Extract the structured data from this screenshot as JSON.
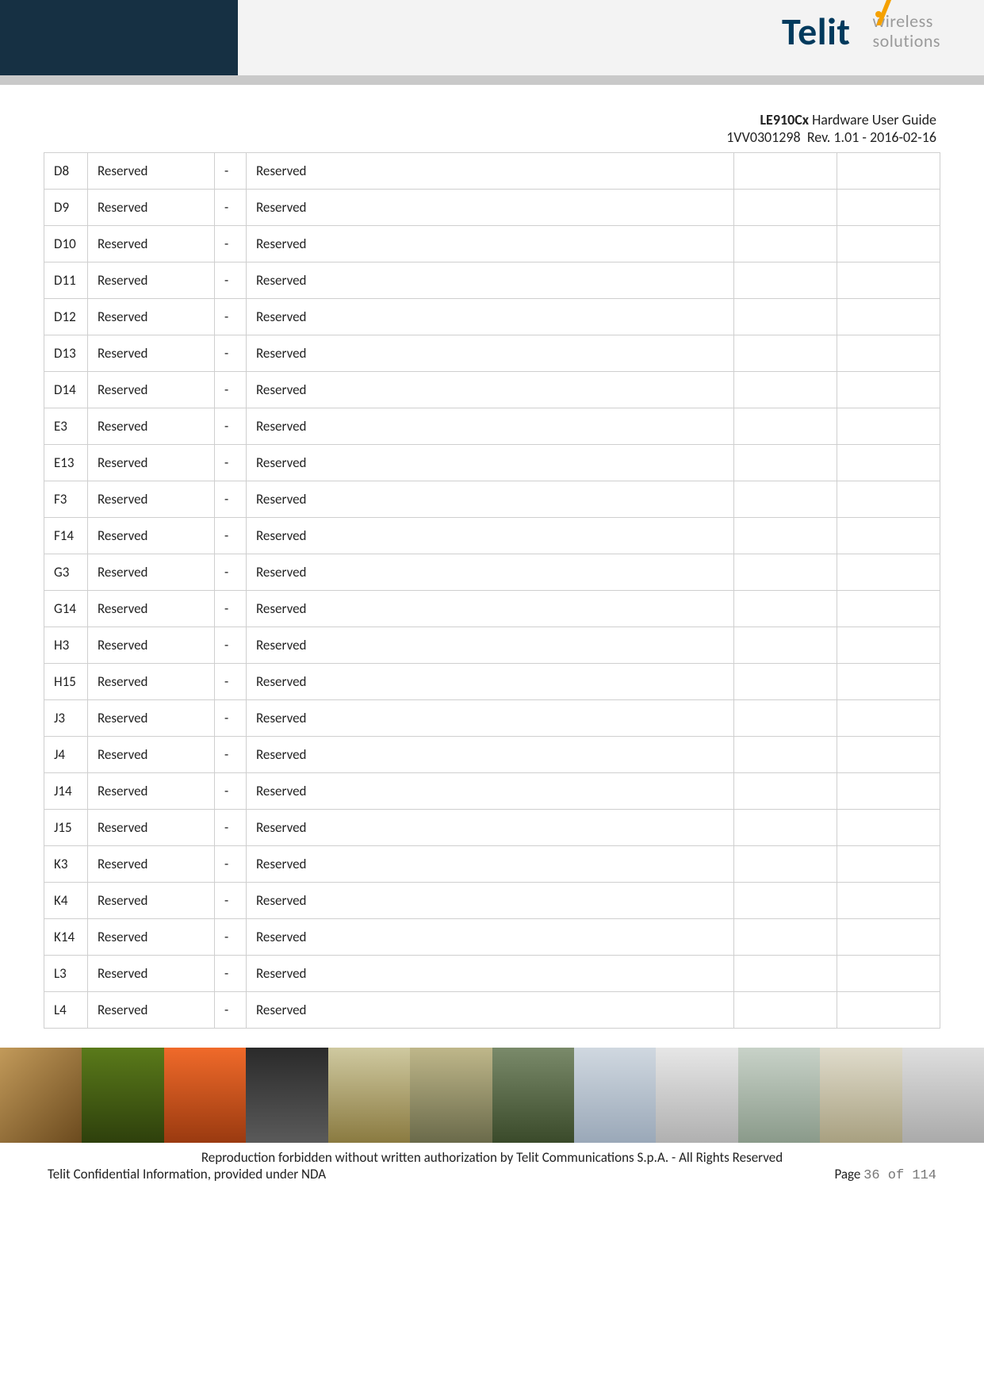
{
  "header": {
    "logo_text": "Telit",
    "tagline_l1": "wireless",
    "tagline_l2": "solutions"
  },
  "meta": {
    "title_bold": "LE910Cx",
    "title_rest": " Hardware User Guide",
    "docnum": "1VV0301298",
    "rev": "Rev. 1.01 - 2016-02-16"
  },
  "rows": [
    {
      "pin": "D8",
      "name": "Reserved",
      "io": "-",
      "func": "Reserved",
      "c5": "",
      "c6": ""
    },
    {
      "pin": "D9",
      "name": "Reserved",
      "io": "-",
      "func": "Reserved",
      "c5": "",
      "c6": ""
    },
    {
      "pin": "D10",
      "name": "Reserved",
      "io": "-",
      "func": "Reserved",
      "c5": "",
      "c6": ""
    },
    {
      "pin": "D11",
      "name": "Reserved",
      "io": "-",
      "func": "Reserved",
      "c5": "",
      "c6": ""
    },
    {
      "pin": "D12",
      "name": "Reserved",
      "io": "-",
      "func": "Reserved",
      "c5": "",
      "c6": ""
    },
    {
      "pin": "D13",
      "name": "Reserved",
      "io": "-",
      "func": "Reserved",
      "c5": "",
      "c6": ""
    },
    {
      "pin": "D14",
      "name": "Reserved",
      "io": "-",
      "func": "Reserved",
      "c5": "",
      "c6": ""
    },
    {
      "pin": "E3",
      "name": "Reserved",
      "io": "-",
      "func": "Reserved",
      "c5": "",
      "c6": ""
    },
    {
      "pin": "E13",
      "name": "Reserved",
      "io": "-",
      "func": "Reserved",
      "c5": "",
      "c6": ""
    },
    {
      "pin": "F3",
      "name": "Reserved",
      "io": "-",
      "func": "Reserved",
      "c5": "",
      "c6": ""
    },
    {
      "pin": "F14",
      "name": "Reserved",
      "io": "-",
      "func": "Reserved",
      "c5": "",
      "c6": ""
    },
    {
      "pin": "G3",
      "name": "Reserved",
      "io": "-",
      "func": "Reserved",
      "c5": "",
      "c6": ""
    },
    {
      "pin": "G14",
      "name": "Reserved",
      "io": "-",
      "func": "Reserved",
      "c5": "",
      "c6": ""
    },
    {
      "pin": "H3",
      "name": "Reserved",
      "io": "-",
      "func": "Reserved",
      "c5": "",
      "c6": ""
    },
    {
      "pin": "H15",
      "name": "Reserved",
      "io": "-",
      "func": "Reserved",
      "c5": "",
      "c6": ""
    },
    {
      "pin": "J3",
      "name": "Reserved",
      "io": "-",
      "func": "Reserved",
      "c5": "",
      "c6": ""
    },
    {
      "pin": "J4",
      "name": "Reserved",
      "io": "-",
      "func": "Reserved",
      "c5": "",
      "c6": ""
    },
    {
      "pin": "J14",
      "name": "Reserved",
      "io": "-",
      "func": "Reserved",
      "c5": "",
      "c6": ""
    },
    {
      "pin": "J15",
      "name": "Reserved",
      "io": "-",
      "func": "Reserved",
      "c5": "",
      "c6": ""
    },
    {
      "pin": "K3",
      "name": "Reserved",
      "io": "-",
      "func": "Reserved",
      "c5": "",
      "c6": ""
    },
    {
      "pin": "K4",
      "name": "Reserved",
      "io": "-",
      "func": "Reserved",
      "c5": "",
      "c6": ""
    },
    {
      "pin": "K14",
      "name": "Reserved",
      "io": "-",
      "func": "Reserved",
      "c5": "",
      "c6": ""
    },
    {
      "pin": "L3",
      "name": "Reserved",
      "io": "-",
      "func": "Reserved",
      "c5": "",
      "c6": ""
    },
    {
      "pin": "L4",
      "name": "Reserved",
      "io": "-",
      "func": "Reserved",
      "c5": "",
      "c6": ""
    }
  ],
  "footer": {
    "line1": "Reproduction forbidden without written authorization by Telit Communications S.p.A. - All Rights Reserved",
    "line2_left": "Telit Confidential Information, provided under NDA",
    "page_label": "Page ",
    "page_num": "36 of 114"
  }
}
